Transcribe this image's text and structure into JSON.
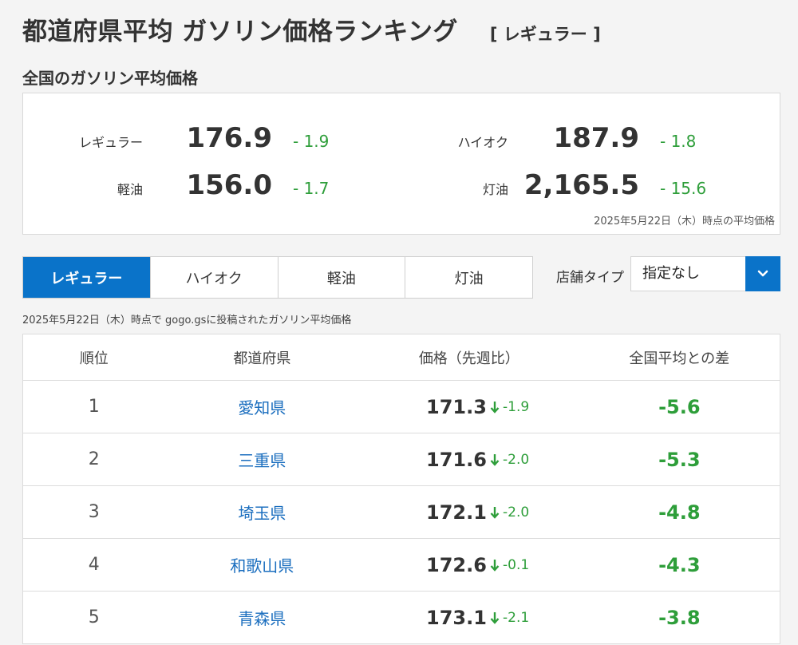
{
  "header": {
    "title": "都道府県平均 ガソリン価格ランキング",
    "tag": "[ レギュラー ]"
  },
  "national": {
    "section_title": "全国のガソリン平均価格",
    "items": [
      {
        "label": "レギュラー",
        "value": "176.9",
        "diff": "- 1.9"
      },
      {
        "label": "ハイオク",
        "value": "187.9",
        "diff": "- 1.8"
      },
      {
        "label": "軽油",
        "value": "156.0",
        "diff": "- 1.7"
      },
      {
        "label": "灯油",
        "value": "2,165.5",
        "diff": "- 15.6"
      }
    ],
    "updated": "2025年5月22日（木）時点の平均価格"
  },
  "tabs": [
    {
      "label": "レギュラー",
      "active": true
    },
    {
      "label": "ハイオク",
      "active": false
    },
    {
      "label": "軽油",
      "active": false
    },
    {
      "label": "灯油",
      "active": false
    }
  ],
  "store_type": {
    "label": "店舗タイプ",
    "value": "指定なし"
  },
  "note": "2025年5月22日（木）時点で gogo.gsに投稿されたガソリン平均価格",
  "table": {
    "headers": [
      "順位",
      "都道府県",
      "価格（先週比）",
      "全国平均との差"
    ],
    "rows": [
      {
        "rank": "1",
        "prefecture": "愛知県",
        "price": "171.3",
        "change": "-1.9",
        "national_diff": "-5.6"
      },
      {
        "rank": "2",
        "prefecture": "三重県",
        "price": "171.6",
        "change": "-2.0",
        "national_diff": "-5.3"
      },
      {
        "rank": "3",
        "prefecture": "埼玉県",
        "price": "172.1",
        "change": "-2.0",
        "national_diff": "-4.8"
      },
      {
        "rank": "4",
        "prefecture": "和歌山県",
        "price": "172.6",
        "change": "-0.1",
        "national_diff": "-4.3"
      },
      {
        "rank": "5",
        "prefecture": "青森県",
        "price": "173.1",
        "change": "-2.1",
        "national_diff": "-3.8"
      }
    ]
  },
  "colors": {
    "accent": "#0a73c9",
    "down": "#2e9e3a",
    "link": "#1c6fbf"
  },
  "icons": {
    "select_toggle": "chevron-down-icon",
    "price_change": "arrow-down-icon"
  }
}
